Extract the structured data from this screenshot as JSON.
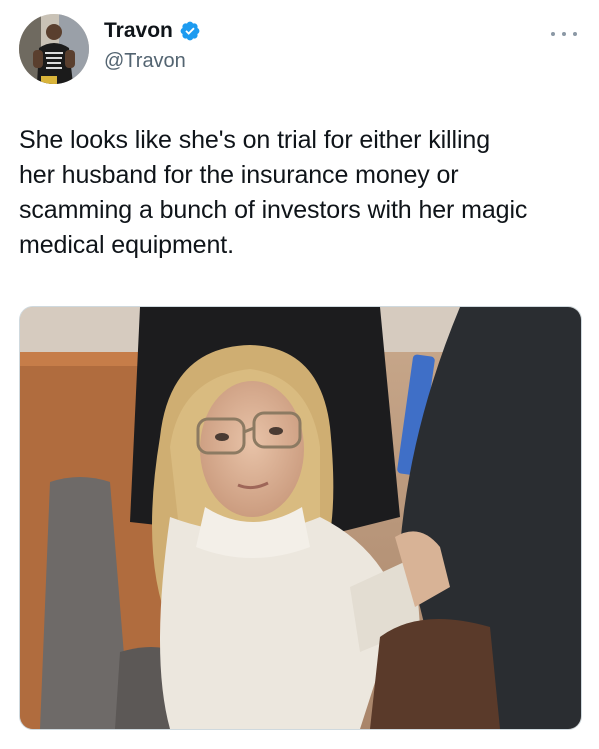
{
  "author": {
    "display_name": "Travon",
    "handle": "@Travon",
    "verified": true,
    "verified_color": "#1d9bf0"
  },
  "tweet": {
    "text": "She looks like she's on trial for either killing\nher husband for the insurance money or\nscamming a bunch of investors with her magic\nmedical equipment."
  },
  "icons": {
    "more": "more-options-icon",
    "verified": "verified-badge-icon"
  },
  "colors": {
    "text": "#0f1419",
    "secondary": "#536471",
    "accent": "#1d9bf0"
  }
}
